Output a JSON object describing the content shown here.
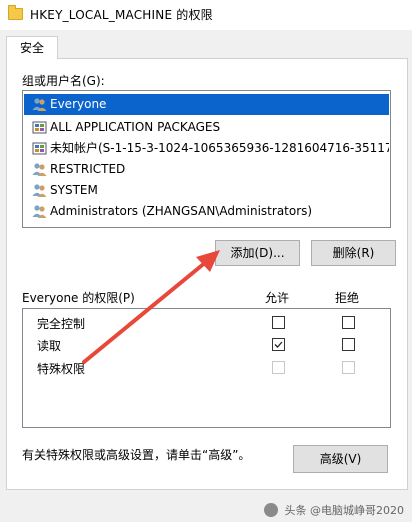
{
  "window": {
    "title": "HKEY_LOCAL_MACHINE 的权限",
    "icon": "folder-icon"
  },
  "tabs": [
    {
      "label": "安全",
      "active": true
    }
  ],
  "users": {
    "label": "组或用户名(G):",
    "items": [
      {
        "name": "Everyone",
        "icon": "users-group-icon",
        "selected": true
      },
      {
        "name": "ALL APPLICATION PACKAGES",
        "icon": "packages-icon",
        "selected": false
      },
      {
        "name": "未知帐户(S-1-15-3-1024-1065365936-1281604716-351173...",
        "icon": "unknown-account-icon",
        "selected": false
      },
      {
        "name": "RESTRICTED",
        "icon": "users-group-icon",
        "selected": false
      },
      {
        "name": "SYSTEM",
        "icon": "users-group-icon",
        "selected": false
      },
      {
        "name": "Administrators (ZHANGSAN\\Administrators)",
        "icon": "users-group-icon",
        "selected": false
      }
    ]
  },
  "buttons": {
    "add": "添加(D)...",
    "remove": "删除(R)",
    "advanced": "高级(V)"
  },
  "permissions": {
    "header": "Everyone 的权限(P)",
    "allow_label": "允许",
    "deny_label": "拒绝",
    "rows": [
      {
        "name": "完全控制",
        "allow": false,
        "deny": false,
        "enabled": true
      },
      {
        "name": "读取",
        "allow": true,
        "deny": false,
        "enabled": true
      },
      {
        "name": "特殊权限",
        "allow": false,
        "deny": false,
        "enabled": false
      }
    ]
  },
  "footer": {
    "note": "有关特殊权限或高级设置，请单击“高级”。"
  },
  "watermark": {
    "text": "头条 @电脑城峥哥2020"
  },
  "colors": {
    "selection": "#0a64cc",
    "arrow": "#e8483a",
    "dialog_bg": "#f0f0f0"
  }
}
